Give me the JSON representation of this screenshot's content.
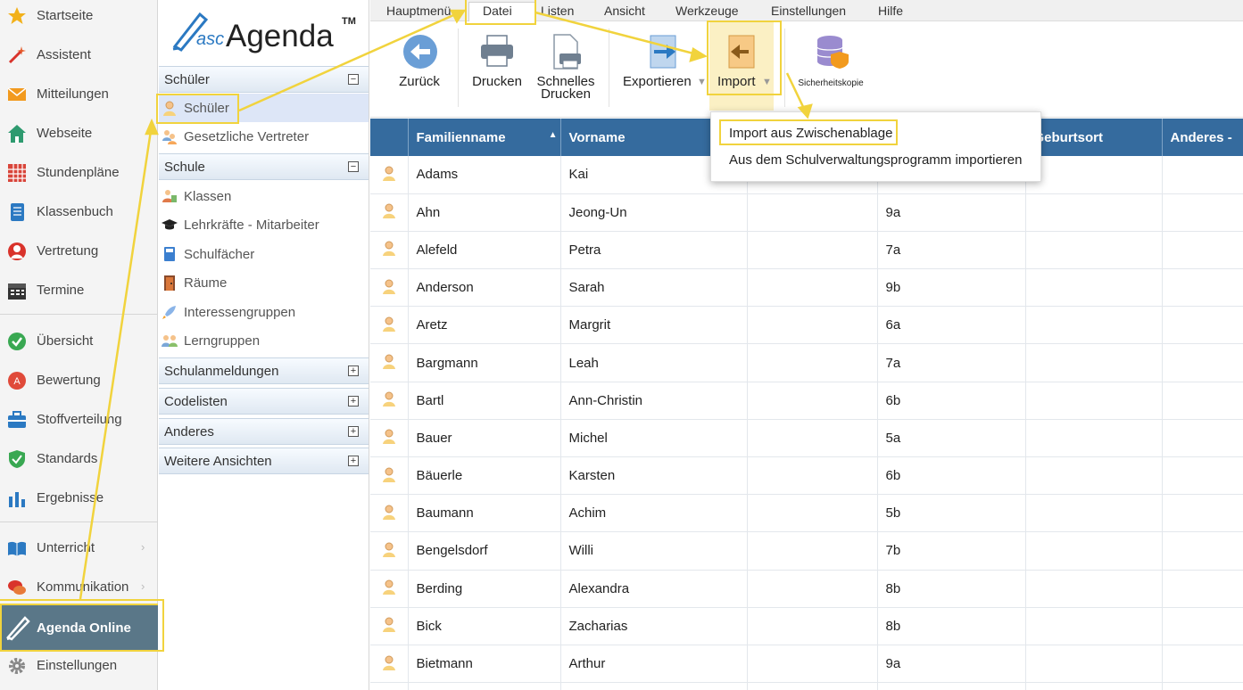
{
  "nav": {
    "items": [
      {
        "label": "Startseite",
        "icon": "star-icon"
      },
      {
        "label": "Assistent",
        "icon": "magic-wand-icon"
      },
      {
        "label": "Mitteilungen",
        "icon": "envelope-icon"
      },
      {
        "label": "Webseite",
        "icon": "house-icon"
      },
      {
        "label": "Stundenpläne",
        "icon": "timetable-icon"
      },
      {
        "label": "Klassenbuch",
        "icon": "class-book-icon"
      },
      {
        "label": "Vertretung",
        "icon": "substitution-icon"
      },
      {
        "label": "Termine",
        "icon": "calendar-icon"
      },
      {
        "label": "Übersicht",
        "icon": "check-circle-icon"
      },
      {
        "label": "Bewertung",
        "icon": "grade-icon"
      },
      {
        "label": "Stoffverteilung",
        "icon": "briefcase-icon"
      },
      {
        "label": "Standards",
        "icon": "shield-check-icon"
      },
      {
        "label": "Ergebnisse",
        "icon": "bar-chart-icon"
      },
      {
        "label": "Unterricht",
        "icon": "open-book-icon"
      },
      {
        "label": "Kommunikation",
        "icon": "chat-icon"
      }
    ],
    "agenda_online": "Agenda Online",
    "settings": "Einstellungen"
  },
  "logo": {
    "prefix": "asc",
    "name": "Agenda",
    "tm": "TM"
  },
  "tree": {
    "schueler_head": "Schüler",
    "schueler_items": [
      "Schüler",
      "Gesetzliche Vertreter"
    ],
    "schule_head": "Schule",
    "schule_items": [
      "Klassen",
      "Lehrkräfte - Mitarbeiter",
      "Schulfächer",
      "Räume",
      "Interessengruppen",
      "Lerngruppen"
    ],
    "collapsed": [
      "Schulanmeldungen",
      "Codelisten",
      "Anderes",
      "Weitere Ansichten"
    ]
  },
  "menubar": [
    "Hauptmenü",
    "Datei",
    "Listen",
    "Ansicht",
    "Werkzeuge",
    "Einstellungen",
    "Hilfe"
  ],
  "ribbon": {
    "back": "Zurück",
    "print": "Drucken",
    "quick_print_1": "Schnelles",
    "quick_print_2": "Drucken",
    "export": "Exportieren",
    "import": "Import",
    "backup": "Sicherheitskopie"
  },
  "dropdown": [
    "Import aus Zwischenablage",
    "Aus dem Schulverwaltungsprogramm importieren"
  ],
  "table": {
    "headers": [
      "Familienname",
      "Vorname",
      "",
      "",
      "Geburtsort",
      "Anderes -"
    ],
    "rows": [
      [
        "Adams",
        "Kai",
        "",
        ""
      ],
      [
        "Ahn",
        "Jeong-Un",
        "",
        "9a"
      ],
      [
        "Alefeld",
        "Petra",
        "",
        "7a"
      ],
      [
        "Anderson",
        "Sarah",
        "",
        "9b"
      ],
      [
        "Aretz",
        "Margrit",
        "",
        "6a"
      ],
      [
        "Bargmann",
        "Leah",
        "",
        "7a"
      ],
      [
        "Bartl",
        "Ann-Christin",
        "",
        "6b"
      ],
      [
        "Bauer",
        "Michel",
        "",
        "5a"
      ],
      [
        "Bäuerle",
        "Karsten",
        "",
        "6b"
      ],
      [
        "Baumann",
        "Achim",
        "",
        "5b"
      ],
      [
        "Bengelsdorf",
        "Willi",
        "",
        "7b"
      ],
      [
        "Berding",
        "Alexandra",
        "",
        "8b"
      ],
      [
        "Bick",
        "Zacharias",
        "",
        "8b"
      ],
      [
        "Bietmann",
        "Arthur",
        "",
        "9a"
      ],
      [
        "",
        "",
        "",
        ""
      ]
    ]
  },
  "colors": {
    "accent": "#356b9e",
    "highlight": "#f1d33d",
    "agenda_bg": "#5a7788"
  }
}
